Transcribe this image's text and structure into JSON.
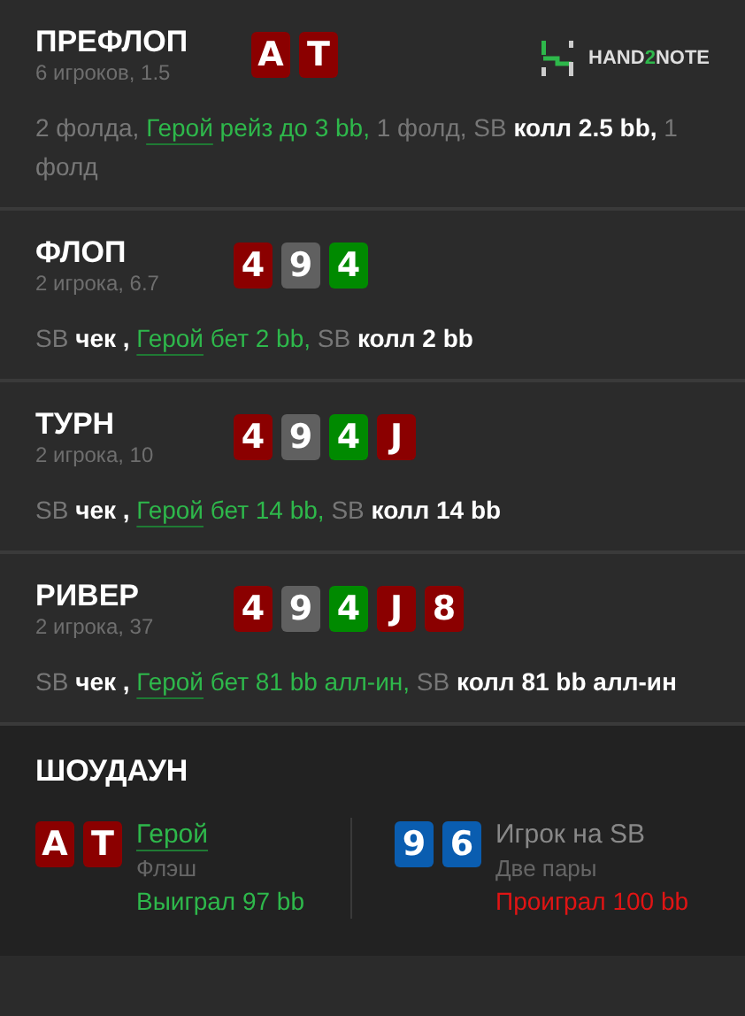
{
  "logo": {
    "before": "HAND",
    "accent": "2",
    "after": "NOTE"
  },
  "streets": [
    {
      "title": "ПРЕФЛОП",
      "info": "6 игроков, 1.5",
      "cards": [
        {
          "rank": "A",
          "color": "#8b0000"
        },
        {
          "rank": "T",
          "color": "#8b0000"
        }
      ],
      "actions": [
        {
          "kind": "muted",
          "text": "2 фолда,"
        },
        {
          "kind": "hero",
          "text": "Герой"
        },
        {
          "kind": "hero_action",
          "text": "рейз до 3 bb,"
        },
        {
          "kind": "muted",
          "text": "1 фолд, SB"
        },
        {
          "kind": "action",
          "text": "колл 2.5 bb,"
        },
        {
          "kind": "muted",
          "text": "1 фолд"
        }
      ]
    },
    {
      "title": "ФЛОП",
      "info": "2 игрока, 6.7",
      "cards": [
        {
          "rank": "4",
          "color": "#8b0000"
        },
        {
          "rank": "9",
          "color": "#606060"
        },
        {
          "rank": "4",
          "color": "#008a00"
        }
      ],
      "actions": [
        {
          "kind": "muted",
          "text": "SB"
        },
        {
          "kind": "action",
          "text": "чек ,"
        },
        {
          "kind": "hero",
          "text": "Герой"
        },
        {
          "kind": "hero_action",
          "text": "бет 2 bb,"
        },
        {
          "kind": "muted",
          "text": "SB"
        },
        {
          "kind": "action",
          "text": "колл 2 bb"
        }
      ]
    },
    {
      "title": "ТУРН",
      "info": "2 игрока, 10",
      "cards": [
        {
          "rank": "4",
          "color": "#8b0000"
        },
        {
          "rank": "9",
          "color": "#606060"
        },
        {
          "rank": "4",
          "color": "#008a00"
        },
        {
          "rank": "J",
          "color": "#8b0000"
        }
      ],
      "actions": [
        {
          "kind": "muted",
          "text": "SB"
        },
        {
          "kind": "action",
          "text": "чек ,"
        },
        {
          "kind": "hero",
          "text": "Герой"
        },
        {
          "kind": "hero_action",
          "text": "бет 14 bb,"
        },
        {
          "kind": "muted",
          "text": "SB"
        },
        {
          "kind": "action",
          "text": "колл 14 bb"
        }
      ]
    },
    {
      "title": "РИВЕР",
      "info": "2 игрока, 37",
      "cards": [
        {
          "rank": "4",
          "color": "#8b0000"
        },
        {
          "rank": "9",
          "color": "#606060"
        },
        {
          "rank": "4",
          "color": "#008a00"
        },
        {
          "rank": "J",
          "color": "#8b0000"
        },
        {
          "rank": "8",
          "color": "#8b0000"
        }
      ],
      "actions": [
        {
          "kind": "muted",
          "text": "SB"
        },
        {
          "kind": "action",
          "text": "чек ,"
        },
        {
          "kind": "hero",
          "text": "Герой"
        },
        {
          "kind": "hero_action",
          "text": "бет 81 bb алл-ин,"
        },
        {
          "kind": "muted",
          "text": "SB"
        },
        {
          "kind": "action",
          "text": "колл 81 bb алл-ин"
        }
      ]
    }
  ],
  "showdown": {
    "title": "ШОУДАУН",
    "players": [
      {
        "name": "Герой",
        "kind": "hero",
        "hand": "Флэш",
        "result": "Выиграл 97 bb",
        "won": true,
        "cards": [
          {
            "rank": "A",
            "color": "#8b0000"
          },
          {
            "rank": "T",
            "color": "#8b0000"
          }
        ]
      },
      {
        "name": "Игрок на SB",
        "kind": "opponent",
        "hand": "Две пары",
        "result": "Проиграл 100 bb",
        "won": false,
        "cards": [
          {
            "rank": "9",
            "color": "#0a5db0"
          },
          {
            "rank": "6",
            "color": "#0a5db0"
          }
        ]
      }
    ]
  }
}
